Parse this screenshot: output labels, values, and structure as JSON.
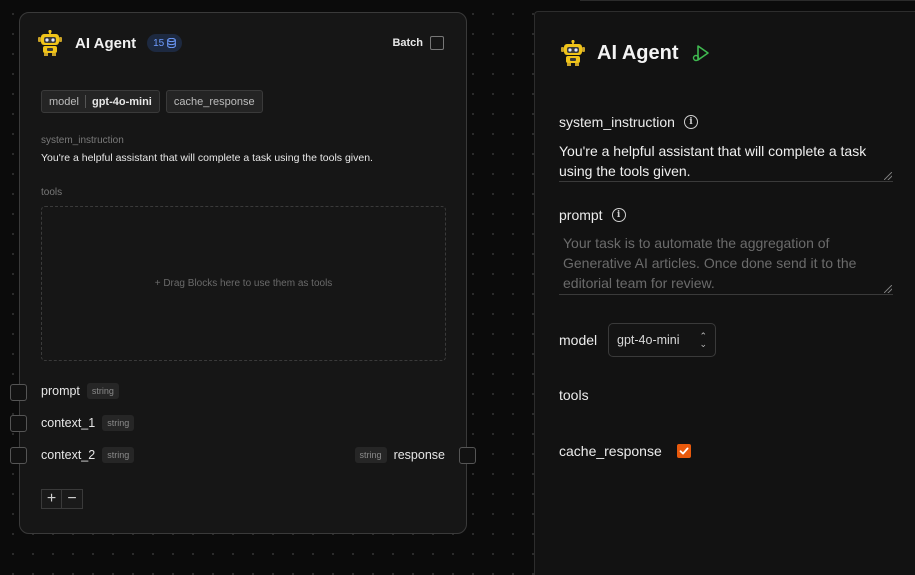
{
  "node": {
    "title": "AI Agent",
    "credits": "15",
    "batch_label": "Batch",
    "chips": {
      "model_key": "model",
      "model_value": "gpt-4o-mini",
      "cache_response": "cache_response"
    },
    "system_instruction_label": "system_instruction",
    "system_instruction_value": "You're a helpful assistant that will complete a task using the tools given.",
    "tools_label": "tools",
    "dropzone_text": "+ Drag Blocks here to use them as tools",
    "inputs": [
      {
        "name": "prompt",
        "type": "string"
      },
      {
        "name": "context_1",
        "type": "string"
      },
      {
        "name": "context_2",
        "type": "string"
      }
    ],
    "output": {
      "name": "response",
      "type": "string"
    },
    "stepper": {
      "add": "+",
      "remove": "−"
    }
  },
  "panel": {
    "title": "AI Agent",
    "system_instruction_label": "system_instruction",
    "system_instruction_value": "You're a helpful assistant that will complete a task using the tools given.",
    "prompt_label": "prompt",
    "prompt_placeholder": "Your task is to automate the aggregation of Generative AI articles. Once done send it to the editorial team for review.",
    "model_label": "model",
    "model_value": "gpt-4o-mini",
    "tools_label": "tools",
    "cache_response_label": "cache_response",
    "cache_response_checked": true
  },
  "colors": {
    "accent_orange": "#e8590c",
    "credit_blue": "#6e9cff",
    "play_green": "#3fb950"
  },
  "icons": {
    "robot": "robot-icon",
    "database": "database-icon",
    "play": "play-icon",
    "info": "info-icon",
    "check": "check-icon"
  }
}
